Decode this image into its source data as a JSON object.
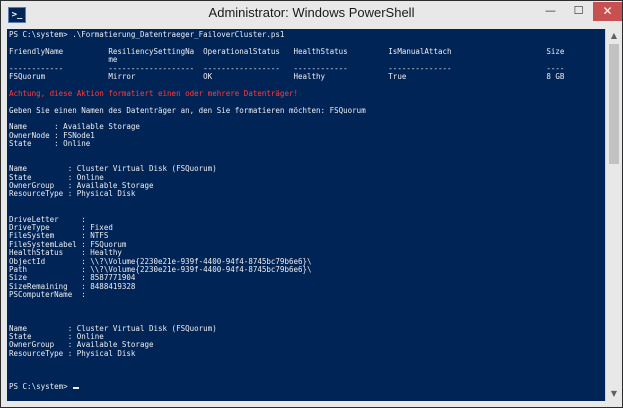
{
  "window": {
    "title": "Administrator: Windows PowerShell",
    "app_icon_glyph": ">_",
    "minimize_glyph": "—",
    "maximize_glyph": "☐",
    "close_glyph": "✕"
  },
  "colors": {
    "console_background": "#012456",
    "console_text": "#eeedf0",
    "warning_text": "#ff3c3c",
    "close_button": "#c75050"
  },
  "scrollbar": {
    "up_glyph": "▲",
    "down_glyph": "▼"
  },
  "console": {
    "command_prompt": "PS C:\\system> .\\Formatierung_Datentraeger_FailoverCluster.ps1",
    "blank_1": "",
    "table_header_1": "FriendlyName          ResiliencySettingNa  OperationalStatus   HealthStatus         IsManualAttach                     Size",
    "table_header_2": "                      me",
    "table_separator": "------------          -------------------  -----------------   ------------         --------------                     ----",
    "table_row": "FSQuorum              Mirror               OK                  Healthy              True                               8 GB",
    "blank_2": "",
    "warning": "Achtung, diese Aktion formatiert einen oder mehrere Datenträger!",
    "blank_3": "",
    "input_prompt": "Geben Sie einen Namen des Datenträger an, den Sie formatieren möchten: FSQuorum",
    "blank_4": "",
    "group1_name": "Name      : Available Storage",
    "group1_owner": "OwnerNode : FSNode1",
    "group1_state": "State     : Online",
    "blank_5": "",
    "blank_6": "",
    "res1_name": "Name         : Cluster Virtual Disk (FSQuorum)",
    "res1_state": "State        : Online",
    "res1_group": "OwnerGroup   : Available Storage",
    "res1_type": "ResourceType : Physical Disk",
    "blank_7": "",
    "blank_8": "",
    "vol_drive_letter": "DriveLetter     :",
    "vol_drive_type": "DriveType       : Fixed",
    "vol_file_system": "FileSystem      : NTFS",
    "vol_label": "FileSystemLabel : FSQuorum",
    "vol_health": "HealthStatus    : Healthy",
    "vol_object_id": "ObjectId        : \\\\?\\Volume{2230e21e-939f-4400-94f4-8745bc79b6e6}\\",
    "vol_path": "Path            : \\\\?\\Volume{2230e21e-939f-4400-94f4-8745bc79b6e6}\\",
    "vol_size": "Size            : 8587771904",
    "vol_size_remaining": "SizeRemaining   : 8488419328",
    "vol_computer_name": "PSComputerName  :",
    "blank_9": "",
    "blank_10": "",
    "blank_11": "",
    "res2_name": "Name         : Cluster Virtual Disk (FSQuorum)",
    "res2_state": "State        : Online",
    "res2_group": "OwnerGroup   : Available Storage",
    "res2_type": "ResourceType : Physical Disk",
    "blank_12": "",
    "blank_13": "",
    "blank_14": "",
    "final_prompt": "PS C:\\system> "
  }
}
